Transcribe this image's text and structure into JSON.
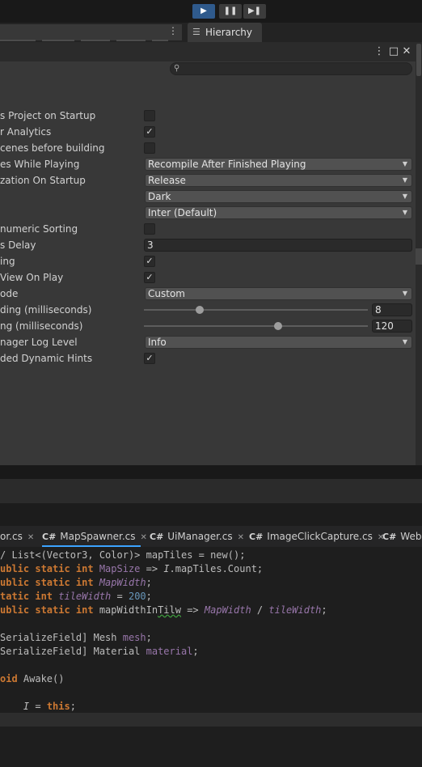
{
  "toolbar": {
    "play_icon": "play-icon",
    "pause_icon": "pause-icon",
    "step_icon": "step-icon",
    "play_glyph": "▶",
    "pause_glyph": "❚❚",
    "step_glyph": "▶❚"
  },
  "hierarchy_tab": {
    "label": "Hierarchy",
    "icon_glyph": "☰"
  },
  "menu_glyph": "⋮",
  "window_controls": {
    "menu": "⋮",
    "maximize": "□",
    "close": "✕"
  },
  "search": {
    "icon": "search-icon",
    "glyph": "⚲",
    "value": ""
  },
  "settings": [
    {
      "label": "s Project on Startup",
      "type": "checkbox",
      "checked": false
    },
    {
      "label": "r Analytics",
      "type": "checkbox",
      "checked": true
    },
    {
      "label": "cenes before building",
      "type": "checkbox",
      "checked": false
    },
    {
      "label": "es While Playing",
      "type": "dropdown",
      "value": "Recompile After Finished Playing"
    },
    {
      "label": "zation On Startup",
      "type": "dropdown",
      "value": "Release"
    },
    {
      "label": "",
      "type": "dropdown",
      "value": "Dark"
    },
    {
      "label": "",
      "type": "dropdown",
      "value": "Inter (Default)"
    },
    {
      "label": "numeric Sorting",
      "type": "checkbox",
      "checked": false
    },
    {
      "label": "s Delay",
      "type": "number",
      "value": "3"
    },
    {
      "label": "ing",
      "type": "checkbox",
      "checked": true
    },
    {
      "label": "View On Play",
      "type": "checkbox",
      "checked": true
    },
    {
      "label": "ode",
      "type": "dropdown",
      "value": "Custom"
    },
    {
      "label": "ding (milliseconds)",
      "type": "slider",
      "value": "8",
      "fraction": 0.25
    },
    {
      "label": "ng (milliseconds)",
      "type": "slider",
      "value": "120",
      "fraction": 0.6
    },
    {
      "label": "nager Log Level",
      "type": "dropdown",
      "value": "Info"
    },
    {
      "label": "ded Dynamic Hints",
      "type": "checkbox",
      "checked": true
    }
  ],
  "check_glyph": "✓",
  "dropdown_glyph": "▼",
  "editor_tabs": [
    {
      "cs": "",
      "name": "or.cs",
      "active": false
    },
    {
      "cs": "C#",
      "name": "MapSpawner.cs",
      "active": true
    },
    {
      "cs": "C#",
      "name": "UiManager.cs",
      "active": false
    },
    {
      "cs": "C#",
      "name": "ImageClickCapture.cs",
      "active": false
    },
    {
      "cs": "C#",
      "name": "Webs",
      "active": false
    }
  ],
  "close_glyph": "✕",
  "code_lines": [
    [
      [
        "c",
        "/ List<(Vector3, Color)> mapTiles = new();"
      ]
    ],
    [
      [
        "kw",
        "ublic static int "
      ],
      [
        "pl",
        "MapSize"
      ],
      [
        "c",
        " => "
      ],
      [
        "it",
        "I"
      ],
      [
        "c",
        ".mapTiles.Count;"
      ]
    ],
    [
      [
        "kw",
        "ublic static int "
      ],
      [
        "pr",
        "MapWidth"
      ],
      [
        "c",
        ";"
      ]
    ],
    [
      [
        "kw",
        "tatic int "
      ],
      [
        "pr",
        "tileWidth"
      ],
      [
        "c",
        " = "
      ],
      [
        "num",
        "200"
      ],
      [
        "c",
        ";"
      ]
    ],
    [
      [
        "kw",
        "ublic static int "
      ],
      [
        "c",
        "mapWidthIn"
      ],
      [
        "sq",
        "Tilw"
      ],
      [
        "c",
        " => "
      ],
      [
        "pr",
        "MapWidth"
      ],
      [
        "c",
        " / "
      ],
      [
        "pr",
        "tileWidth"
      ],
      [
        "c",
        ";"
      ]
    ],
    [
      [
        "c",
        ""
      ]
    ],
    [
      [
        "c",
        "SerializeField] Mesh "
      ],
      [
        "pl",
        "mesh"
      ],
      [
        "c",
        ";"
      ]
    ],
    [
      [
        "c",
        "SerializeField] Material "
      ],
      [
        "pl",
        "material"
      ],
      [
        "c",
        ";"
      ]
    ],
    [
      [
        "c",
        ""
      ]
    ],
    [
      [
        "kw",
        "oid "
      ],
      [
        "c",
        "Awake()"
      ]
    ],
    [
      [
        "c",
        ""
      ]
    ],
    [
      [
        "c",
        "    "
      ],
      [
        "it",
        "I"
      ],
      [
        "c",
        " = "
      ],
      [
        "kw",
        "this"
      ],
      [
        "c",
        ";"
      ]
    ]
  ]
}
